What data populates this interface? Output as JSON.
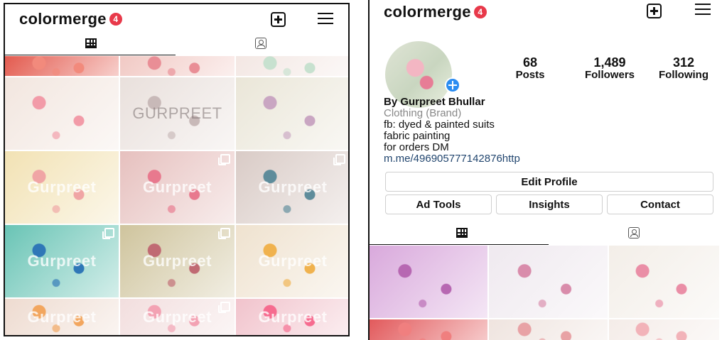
{
  "left": {
    "brand": "colormerge",
    "badge": "4",
    "watermarks": [
      "",
      "",
      "",
      "",
      "GURPREET",
      "",
      "Gurpreet",
      "Gurpreet",
      "Gurpreet",
      "Gurpreet",
      "Gurpreet",
      "Gurpreet",
      "Gurpreet",
      "Gurpreet",
      "Gurpreet"
    ],
    "tile_colors": [
      "#e35a4e",
      "#f1c9c4",
      "#f3e7e3",
      "#f2e6df",
      "#e9e0dc",
      "#eae6d8",
      "#f2e2b4",
      "#e6c0be",
      "#d9cbc6",
      "#69c4b5",
      "#cfc49d",
      "#efe2cf",
      "#eedbd0",
      "#f2dede",
      "#f1c3cc"
    ],
    "tile_accents": [
      "#f28a7c",
      "#e98e96",
      "#c7e1cf",
      "#f29ba8",
      "#c8b9b8",
      "#c9a6c2",
      "#f0a5a5",
      "#e8798e",
      "#5e8c9b",
      "#2f77b7",
      "#c06a73",
      "#f0b24e",
      "#f2a65f",
      "#f3a2b3",
      "#f66b8f"
    ],
    "multi": [
      false,
      false,
      false,
      false,
      false,
      false,
      false,
      true,
      true,
      true,
      true,
      false,
      false,
      true,
      false
    ]
  },
  "right": {
    "brand": "colormerge",
    "badge": "4",
    "stats": [
      {
        "num": "68",
        "label": "Posts"
      },
      {
        "num": "1,489",
        "label": "Followers"
      },
      {
        "num": "312",
        "label": "Following"
      }
    ],
    "bio": {
      "name": "By Gurpreet Bhullar",
      "category": "Clothing (Brand)",
      "line1": "fb: dyed & painted suits",
      "line2": "fabric painting",
      "line3": "for orders DM",
      "link": "m.me/496905777142876http"
    },
    "buttons": {
      "edit_profile": "Edit Profile",
      "ad_tools": "Ad Tools",
      "insights": "Insights",
      "contact": "Contact"
    },
    "tile_colors": [
      "#d9a9dc",
      "#efe9ef",
      "#f3eee8",
      "#e25a5c",
      "#efe4df",
      "#f4ece8"
    ],
    "tile_accents": [
      "#b768b2",
      "#d98cab",
      "#ea8ea6",
      "#f07f7f",
      "#e8a2a5",
      "#f2b3b9"
    ]
  }
}
